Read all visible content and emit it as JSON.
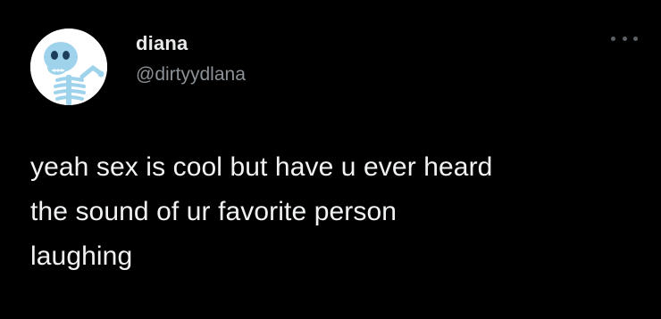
{
  "tweet": {
    "author": {
      "display_name": "diana",
      "handle": "@dirtyydlana",
      "avatar_icon": "skeleton-avatar-icon"
    },
    "more_icon": "more-dots-icon",
    "text_lines": [
      "yeah sex is cool but have u ever heard",
      "the sound of ur favorite person",
      "laughing"
    ]
  },
  "colors": {
    "background": "#000000",
    "name": "#e7e9ea",
    "handle": "#8b9196",
    "text": "#f0f2f3",
    "skeleton": "#9fd3ec"
  }
}
